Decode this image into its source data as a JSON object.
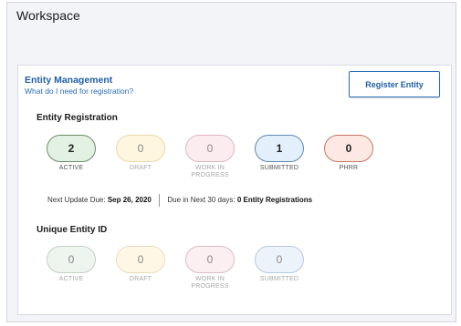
{
  "workspace": {
    "title": "Workspace"
  },
  "entity_management": {
    "title": "Entity Management",
    "link": "What do I need for registration?",
    "register_label": "Register Entity"
  },
  "entity_registration": {
    "title": "Entity Registration",
    "statuses": [
      {
        "count": "2",
        "label": "ACTIVE",
        "fill": "#e3f1e3",
        "border": "#6d8c6d",
        "muted": false
      },
      {
        "count": "0",
        "label": "DRAFT",
        "fill": "#fff6e0",
        "border": "#ead9a8",
        "muted": true
      },
      {
        "count": "0",
        "label": "WORK IN PROGRESS",
        "fill": "#fbecef",
        "border": "#dcb7bf",
        "muted": true
      },
      {
        "count": "1",
        "label": "SUBMITTED",
        "fill": "#e3f0fb",
        "border": "#5f87b3",
        "muted": false
      },
      {
        "count": "0",
        "label": "PHRR",
        "fill": "#fde8e3",
        "border": "#c8765f",
        "muted": false
      }
    ],
    "next_update_label": "Next Update Due:",
    "next_update_date": "Sep 26, 2020",
    "due_label": "Due in Next 30 days:",
    "due_value": "0 Entity Registrations"
  },
  "unique_entity_id": {
    "title": "Unique Entity ID",
    "statuses": [
      {
        "count": "0",
        "label": "ACTIVE",
        "fill": "#eef4ee",
        "border": "#c3d1c3",
        "muted": true
      },
      {
        "count": "0",
        "label": "DRAFT",
        "fill": "#fff7e6",
        "border": "#eadcb6",
        "muted": true
      },
      {
        "count": "0",
        "label": "WORK IN PROGRESS",
        "fill": "#fbeff1",
        "border": "#dcbcc3",
        "muted": true
      },
      {
        "count": "0",
        "label": "SUBMITTED",
        "fill": "#edf3fa",
        "border": "#b8c9dc",
        "muted": true
      }
    ]
  }
}
